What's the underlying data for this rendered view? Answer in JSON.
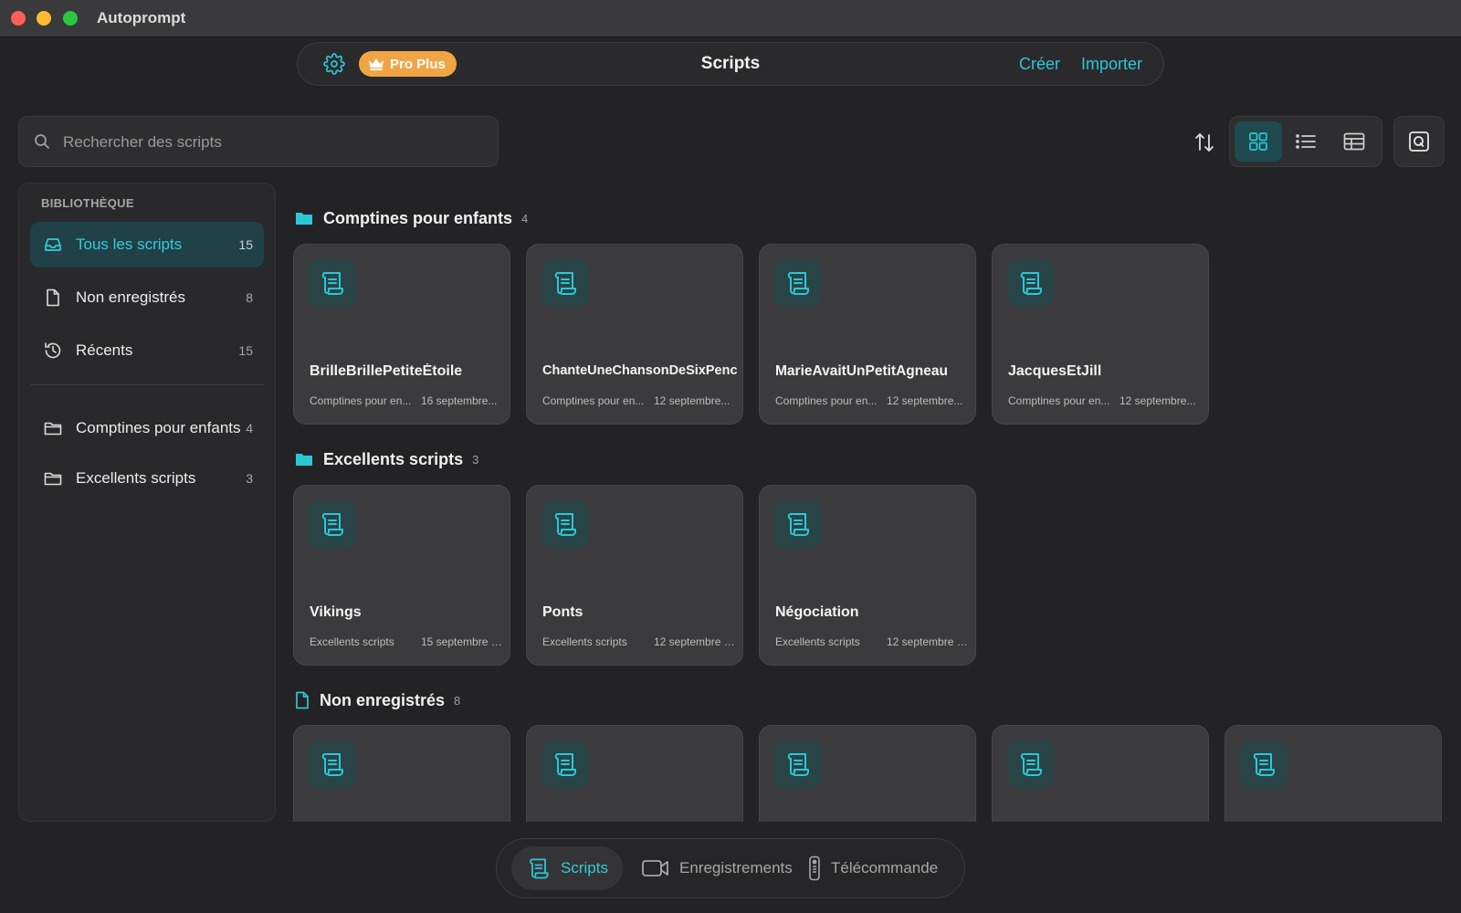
{
  "window": {
    "title": "Autoprompt"
  },
  "toolbar": {
    "badge": "Pro Plus",
    "title": "Scripts",
    "create": "Créer",
    "import": "Importer"
  },
  "search": {
    "placeholder": "Rechercher des scripts"
  },
  "colors": {
    "accent": "#2cc7d6",
    "badge": "#f0a545",
    "background": "#232325"
  },
  "sidebar": {
    "heading": "BIBLIOTHÈQUE",
    "library": [
      {
        "label": "Tous les scripts",
        "count": "15",
        "icon": "tray-icon",
        "active": true
      },
      {
        "label": "Non enregistrés",
        "count": "8",
        "icon": "document-icon"
      },
      {
        "label": "Récents",
        "count": "15",
        "icon": "history-icon"
      }
    ],
    "folders": [
      {
        "label": "Comptines pour enfants",
        "count": "4",
        "icon": "folder-icon"
      },
      {
        "label": "Excellents scripts",
        "count": "3",
        "icon": "folder-icon"
      }
    ]
  },
  "sections": [
    {
      "label": "Comptines pour enfants",
      "count": "4",
      "cards": [
        {
          "title": "BrilleBrillePetiteÉtoile",
          "folder": "Comptines pour en...",
          "date": "16 septembre..."
        },
        {
          "title": "ChanteUneChansonDeSixPence",
          "folder": "Comptines pour en...",
          "date": "12 septembre..."
        },
        {
          "title": "MarieAvaitUnPetitAgneau",
          "folder": "Comptines pour en...",
          "date": "12 septembre..."
        },
        {
          "title": "JacquesEtJill",
          "folder": "Comptines pour en...",
          "date": "12 septembre..."
        }
      ]
    },
    {
      "label": "Excellents scripts",
      "count": "3",
      "cards": [
        {
          "title": "Vikings",
          "folder": "Excellents scripts",
          "date": "15 septembre 2..."
        },
        {
          "title": "Ponts",
          "folder": "Excellents scripts",
          "date": "12 septembre 2..."
        },
        {
          "title": "Négociation",
          "folder": "Excellents scripts",
          "date": "12 septembre 2..."
        }
      ]
    },
    {
      "label": "Non enregistrés",
      "count": "8",
      "cards": [
        {},
        {},
        {},
        {},
        {}
      ]
    }
  ],
  "tabs": {
    "scripts": "Scripts",
    "recordings": "Enregistrements",
    "remote": "Télécommande"
  }
}
